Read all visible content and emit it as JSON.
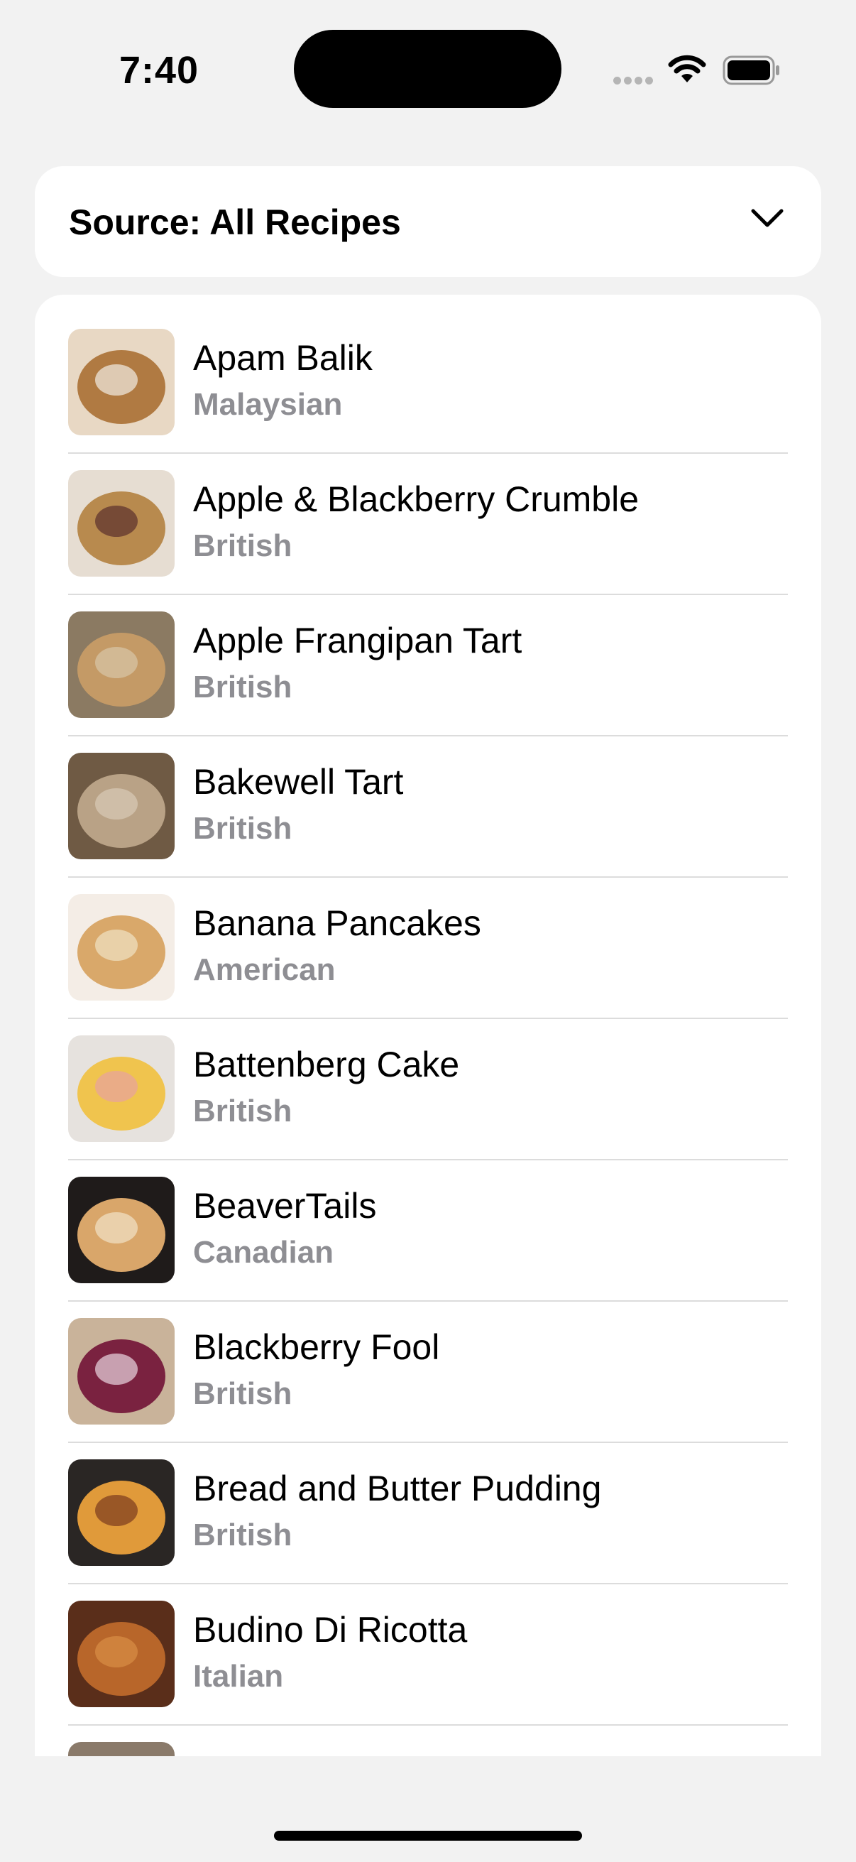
{
  "status_bar": {
    "time": "7:40"
  },
  "source_picker": {
    "label": "Source: All Recipes"
  },
  "recipes": [
    {
      "name": "Apam Balik",
      "cuisine": "Malaysian",
      "thumb_colors": [
        "#e8d8c4",
        "#b07a42",
        "#f2ece4"
      ]
    },
    {
      "name": "Apple & Blackberry Crumble",
      "cuisine": "British",
      "thumb_colors": [
        "#e6ddd2",
        "#b88a4e",
        "#5a2f2c"
      ]
    },
    {
      "name": "Apple Frangipan Tart",
      "cuisine": "British",
      "thumb_colors": [
        "#8b7a62",
        "#c49a66",
        "#d9c6a8"
      ]
    },
    {
      "name": "Bakewell Tart",
      "cuisine": "British",
      "thumb_colors": [
        "#6f5a44",
        "#b9a286",
        "#d8cbb6"
      ]
    },
    {
      "name": "Banana Pancakes",
      "cuisine": "American",
      "thumb_colors": [
        "#f4ede6",
        "#d9a86a",
        "#f0e3c4"
      ]
    },
    {
      "name": "Battenberg Cake",
      "cuisine": "British",
      "thumb_colors": [
        "#e6e2de",
        "#f0c44e",
        "#e7a2a0"
      ]
    },
    {
      "name": "BeaverTails",
      "cuisine": "Canadian",
      "thumb_colors": [
        "#1f1b1a",
        "#d9a66a",
        "#f1e2c8"
      ]
    },
    {
      "name": "Blackberry Fool",
      "cuisine": "British",
      "thumb_colors": [
        "#c9b39a",
        "#7a2240",
        "#e9d6df"
      ]
    },
    {
      "name": "Bread and Butter Pudding",
      "cuisine": "British",
      "thumb_colors": [
        "#2a2624",
        "#e09a3a",
        "#7a3a1e"
      ]
    },
    {
      "name": "Budino Di Ricotta",
      "cuisine": "Italian",
      "thumb_colors": [
        "#5a2e1a",
        "#b8662a",
        "#d88e46"
      ]
    },
    {
      "name": "",
      "cuisine": "",
      "thumb_colors": [
        "#8a7a6a",
        "#d8d0c6",
        "#4a4038"
      ]
    }
  ]
}
